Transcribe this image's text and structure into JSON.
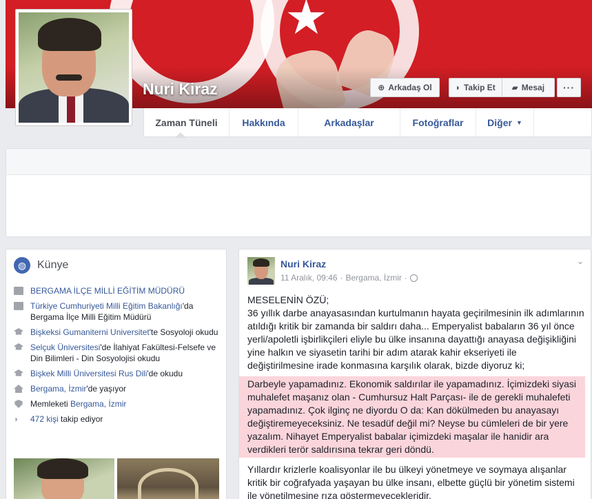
{
  "profile": {
    "name": "Nuri Kiraz"
  },
  "cover_buttons": {
    "add_friend": "Arkadaş Ol",
    "follow": "Takip Et",
    "message": "Mesaj",
    "more": "···"
  },
  "nav": {
    "tabs": [
      {
        "label": "Zaman Tüneli"
      },
      {
        "label": "Hakkında"
      },
      {
        "label": "Arkadaşlar"
      },
      {
        "label": "Fotoğraflar"
      },
      {
        "label": "Diğer"
      }
    ]
  },
  "intro": {
    "title": "Künye",
    "rows": [
      {
        "icon": "briefcase-icon",
        "link": "BERGAMA İLÇE MİLLİ EĞİTİM MÜDÜRÜ",
        "text": ""
      },
      {
        "icon": "briefcase-icon",
        "link": "Türkiye Cumhuriyeti Milli Eğitim Bakanlığı",
        "text": "'da Bergama İlçe Milli Eğitim Müdürü"
      },
      {
        "icon": "graduation-cap-icon",
        "link": "Bişkeksi Gumaniterni Universitet",
        "text": "'te Sosyoloji okudu"
      },
      {
        "icon": "graduation-cap-icon",
        "link": "Selçuk Üniversitesi",
        "text": "'de İlahiyat Fakültesi-Felsefe ve Din Bilimleri - Din Sosyolojisi okudu"
      },
      {
        "icon": "graduation-cap-icon",
        "link": "Bişkek Milli Üniversitesi Rus Dili",
        "text": "'de okudu"
      },
      {
        "icon": "home-icon",
        "link": "Bergama, İzmir",
        "text": "'de yaşıyor"
      },
      {
        "icon": "location-pin-icon",
        "prefix": "Memleketi ",
        "link": "Bergama, İzmir",
        "text": ""
      },
      {
        "icon": "rss-icon",
        "link": "472 kişi",
        "text": " takip ediyor"
      }
    ]
  },
  "post": {
    "author": "Nuri Kiraz",
    "date": "11 Aralık, 09:46",
    "location": "Bergama, İzmir",
    "para1": "MESELENİN ÖZÜ;",
    "para2": "36 yıllık darbe anayasasından kurtulmanın hayata geçirilmesinin ilk adımlarının atıldığı kritik bir zamanda bir saldırı daha... Emperyalist babaların 36 yıl önce yerli/apoletli işbirlikçileri eliyle bu ülke insanına dayattığı anayasa değişikliğini yine halkın ve siyasetin tarihi bir adım atarak kahir ekseriyeti ile değiştirilmesine irade konmasına karşılık olarak, bizde diyoruz ki;",
    "highlight": "Darbeyle yapamadınız. Ekonomik saldırılar ile yapamadınız. İçimizdeki siyasi muhalefet maşanız olan - Cumhursuz Halt Parçası- ile de gerekli muhalefeti yapamadınız. Çok ilginç ne diyordu O da: Kan dökülmeden bu anayasayı değiştiremeyeceksiniz. Ne tesadüf değil mi? Neyse bu cümleleri de bir yere yazalım. Nihayet Emperyalist babalar içimizdeki maşalar ile hanidir ara verdikleri terör saldırısına tekrar geri döndü.",
    "para3": "Yıllardır krizlerle koalisyonlar ile bu ülkeyi yönetmeye ve soymaya alışanlar kritik bir coğrafyada yaşayan bu ülke insanı, elbette güçlü bir yönetim sistemi ile yönetilmesine rıza göstermeyecekleridir."
  },
  "colors": {
    "cover_red": "#d21e24",
    "link_blue": "#365899",
    "highlight_pink": "#fbd5dc"
  }
}
